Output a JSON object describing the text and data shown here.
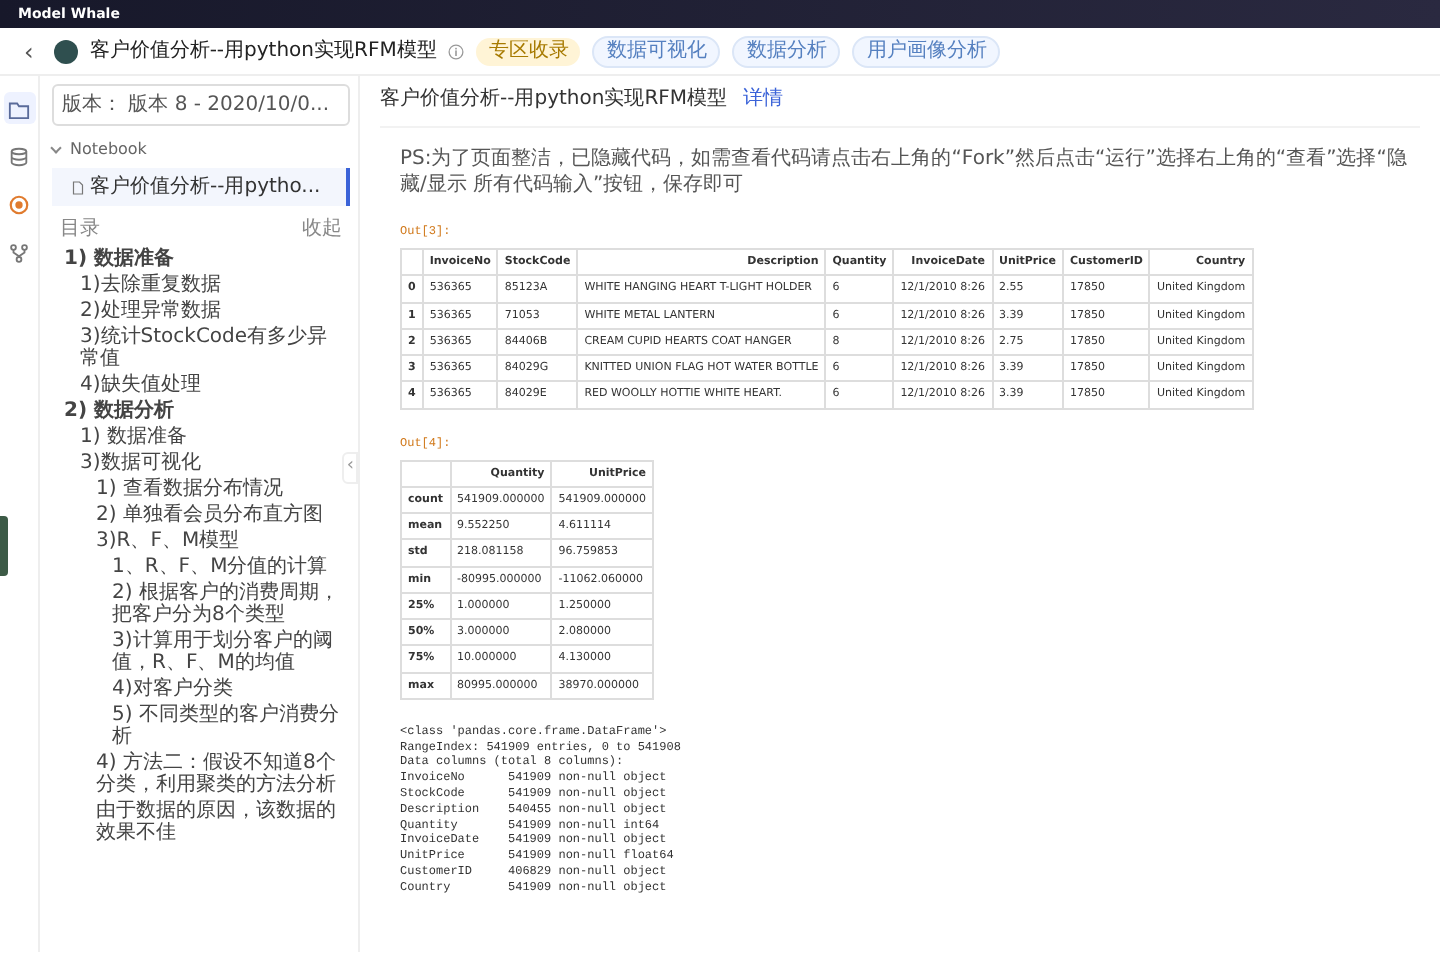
{
  "app_bar": {
    "brand": "Model Whale"
  },
  "header": {
    "back": "‹",
    "title": "客户价值分析--用python实现RFM模型",
    "tags": [
      {
        "label": "专区收录",
        "kind": "featured"
      },
      {
        "label": "数据可视化",
        "kind": "topic"
      },
      {
        "label": "数据分析",
        "kind": "topic"
      },
      {
        "label": "用户画像分析",
        "kind": "topic"
      }
    ]
  },
  "rail": [
    {
      "kind": "folder",
      "selected": true
    },
    {
      "kind": "database",
      "selected": false
    },
    {
      "kind": "target",
      "selected": false
    },
    {
      "kind": "branch",
      "selected": false
    }
  ],
  "sidebar": {
    "version": "版本： 版本 8 - 2020/10/0...",
    "tree": {
      "label": "Notebook",
      "expanded": true,
      "files": [
        {
          "label": "客户价值分析--用pytho...",
          "selected": true
        }
      ]
    },
    "toc_title": "目录",
    "toc_toggle": "收起",
    "collapse": "‹",
    "toc": [
      {
        "label": "1) 数据准备",
        "children": [
          {
            "label": "1)去除重复数据"
          },
          {
            "label": "2)处理异常数据"
          },
          {
            "label": "3)统计StockCode有多少异常值"
          },
          {
            "label": "4)缺失值处理"
          }
        ]
      },
      {
        "label": "2) 数据分析",
        "children": [
          {
            "label": "1) 数据准备"
          },
          {
            "label": "3)数据可视化",
            "children": [
              {
                "label": "1) 查看数据分布情况"
              },
              {
                "label": "2) 单独看会员分布直方图"
              },
              {
                "label": "3)R、F、M模型",
                "children": [
                  {
                    "label": "1、R、F、M分值的计算"
                  },
                  {
                    "label": "2) 根据客户的消费周期，把客户分为8个类型"
                  },
                  {
                    "label": "3)计算用于划分客户的阈值，R、F、M的均值"
                  },
                  {
                    "label": "4)对客户分类"
                  },
                  {
                    "label": "5) 不同类型的客户消费分析"
                  }
                ]
              },
              {
                "label": "4) 方法二：假设不知道8个分类，利用聚类的方法分析"
              },
              {
                "label": "由于数据的原因，该数据的效果不佳"
              }
            ]
          }
        ]
      }
    ]
  },
  "main": {
    "title": "客户价值分析--用python实现RFM模型",
    "details_link": "详情",
    "note": "PS:为了页面整洁，已隐藏代码，如需查看代码请点击右上角的“Fork”然后点击“运行”选择右上角的“查看”选择“隐藏/显示 所有代码输入”按钮，保存即可",
    "outputs": [
      {
        "kind": "table",
        "prompt": "Out[3]:",
        "columns": [
          "",
          "InvoiceNo",
          "StockCode",
          "Description",
          "Quantity",
          "InvoiceDate",
          "UnitPrice",
          "CustomerID",
          "Country"
        ],
        "rows": [
          [
            "0",
            "536365",
            "85123A",
            "WHITE HANGING HEART T-LIGHT HOLDER",
            "6",
            "12/1/2010 8:26",
            "2.55",
            "17850",
            "United Kingdom"
          ],
          [
            "1",
            "536365",
            "71053",
            "WHITE METAL LANTERN",
            "6",
            "12/1/2010 8:26",
            "3.39",
            "17850",
            "United Kingdom"
          ],
          [
            "2",
            "536365",
            "84406B",
            "CREAM CUPID HEARTS COAT HANGER",
            "8",
            "12/1/2010 8:26",
            "2.75",
            "17850",
            "United Kingdom"
          ],
          [
            "3",
            "536365",
            "84029G",
            "KNITTED UNION FLAG HOT WATER BOTTLE",
            "6",
            "12/1/2010 8:26",
            "3.39",
            "17850",
            "United Kingdom"
          ],
          [
            "4",
            "536365",
            "84029E",
            "RED WOOLLY HOTTIE WHITE HEART.",
            "6",
            "12/1/2010 8:26",
            "3.39",
            "17850",
            "United Kingdom"
          ]
        ]
      },
      {
        "kind": "table",
        "prompt": "Out[4]:",
        "columns": [
          "",
          "Quantity",
          "UnitPrice"
        ],
        "rows": [
          [
            "count",
            "541909.000000",
            "541909.000000"
          ],
          [
            "mean",
            "9.552250",
            "4.611114"
          ],
          [
            "std",
            "218.081158",
            "96.759853"
          ],
          [
            "min",
            "-80995.000000",
            "-11062.060000"
          ],
          [
            "25%",
            "1.000000",
            "1.250000"
          ],
          [
            "50%",
            "3.000000",
            "2.080000"
          ],
          [
            "75%",
            "10.000000",
            "4.130000"
          ],
          [
            "max",
            "80995.000000",
            "38970.000000"
          ]
        ]
      },
      {
        "kind": "text",
        "lines": [
          "<class 'pandas.core.frame.DataFrame'>",
          "RangeIndex: 541909 entries, 0 to 541908",
          "Data columns (total 8 columns):",
          "InvoiceNo      541909 non-null object",
          "StockCode      541909 non-null object",
          "Description    540455 non-null object",
          "Quantity       541909 non-null int64",
          "InvoiceDate    541909 non-null object",
          "UnitPrice      541909 non-null float64",
          "CustomerID     406829 non-null object",
          "Country        541909 non-null object"
        ]
      }
    ]
  }
}
